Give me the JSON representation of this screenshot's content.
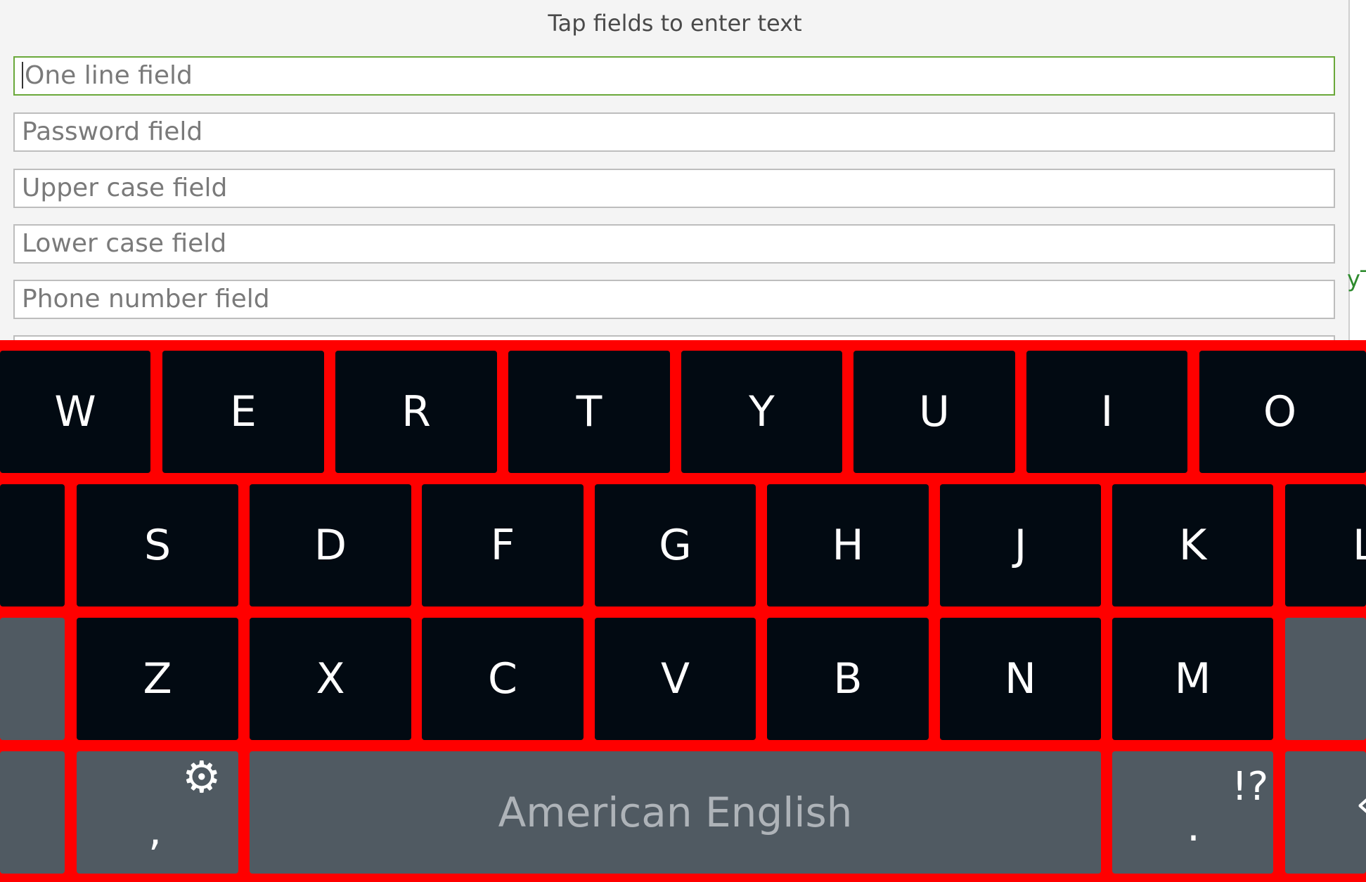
{
  "header": {
    "instructions": "Tap fields to enter text"
  },
  "fields": {
    "one_line": {
      "placeholder": "One line field",
      "value": ""
    },
    "password": {
      "placeholder": "Password field",
      "value": ""
    },
    "upper_case": {
      "placeholder": "Upper case field",
      "value": ""
    },
    "lower_case": {
      "placeholder": "Lower case field",
      "value": ""
    },
    "phone_number": {
      "placeholder": "Phone number field",
      "value": ""
    }
  },
  "right_edge_text": "yT",
  "keyboard": {
    "row1": [
      "W",
      "E",
      "R",
      "T",
      "Y",
      "U",
      "I",
      "O"
    ],
    "row2": [
      "S",
      "D",
      "F",
      "G",
      "H",
      "J",
      "K",
      "L"
    ],
    "row3": [
      "Z",
      "X",
      "C",
      "V",
      "B",
      "N",
      "M"
    ],
    "bottom": {
      "comma_key_main": ",",
      "settings_icon": "⚙",
      "space_label": "American English",
      "period_key_main": ".",
      "symbols_label": "!?",
      "right_edge_glyph": "‹"
    }
  },
  "colors": {
    "keyboard_background": "#ff0000",
    "letter_key": "#020a12",
    "function_key": "#505a62",
    "focused_field_border": "#6aa83a",
    "field_border": "#bdbdbd",
    "panel_background": "#f4f4f4"
  }
}
